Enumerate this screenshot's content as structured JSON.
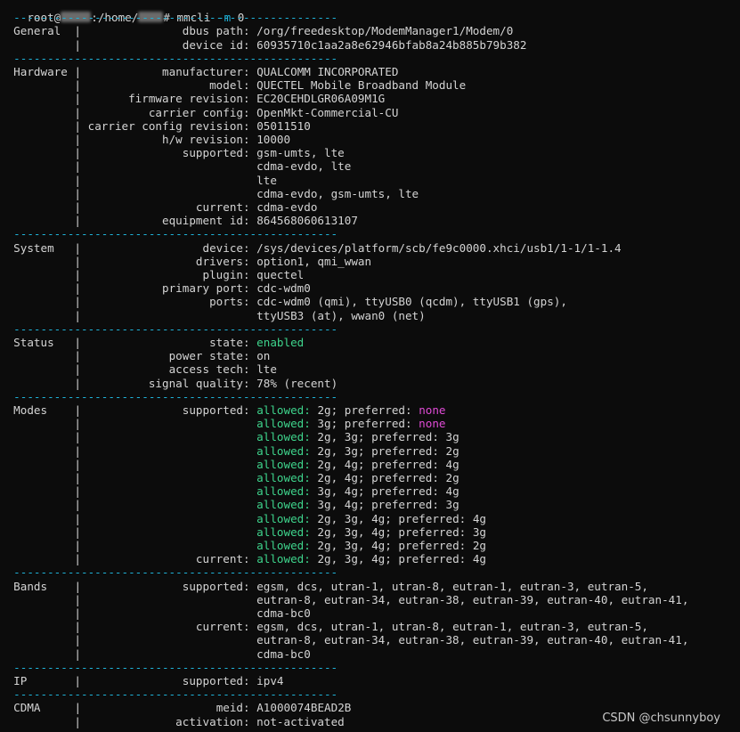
{
  "prompt": {
    "user": "root@",
    "path_a": ":/home/",
    "path_b": "# ",
    "command": "mmcli ",
    "flag": "-m",
    "arg": " 0"
  },
  "separator": "------------------------------------------------",
  "sections": [
    {
      "name": "General",
      "rows": [
        {
          "key": "dbus path:",
          "parts": [
            {
              "t": "/org/freedesktop/ModemManager1/Modem/0"
            }
          ]
        },
        {
          "key": "device id:",
          "parts": [
            {
              "t": "60935710c1aa2a8e62946bfab8a24b885b79b382"
            }
          ]
        }
      ]
    },
    {
      "name": "Hardware",
      "rows": [
        {
          "key": "manufacturer:",
          "parts": [
            {
              "t": "QUALCOMM INCORPORATED"
            }
          ]
        },
        {
          "key": "model:",
          "parts": [
            {
              "t": "QUECTEL Mobile Broadband Module"
            }
          ]
        },
        {
          "key": "firmware revision:",
          "parts": [
            {
              "t": "EC20CEHDLGR06A09M1G"
            }
          ]
        },
        {
          "key": "carrier config:",
          "parts": [
            {
              "t": "OpenMkt-Commercial-CU"
            }
          ]
        },
        {
          "key": "carrier config revision:",
          "parts": [
            {
              "t": "05011510"
            }
          ]
        },
        {
          "key": "h/w revision:",
          "parts": [
            {
              "t": "10000"
            }
          ]
        },
        {
          "key": "supported:",
          "parts": [
            {
              "t": "gsm-umts, lte"
            }
          ]
        },
        {
          "key": "",
          "parts": [
            {
              "t": "cdma-evdo, lte"
            }
          ]
        },
        {
          "key": "",
          "parts": [
            {
              "t": "lte"
            }
          ]
        },
        {
          "key": "",
          "parts": [
            {
              "t": "cdma-evdo, gsm-umts, lte"
            }
          ]
        },
        {
          "key": "current:",
          "parts": [
            {
              "t": "cdma-evdo"
            }
          ]
        },
        {
          "key": "equipment id:",
          "parts": [
            {
              "t": "864568060613107"
            }
          ]
        }
      ]
    },
    {
      "name": "System",
      "rows": [
        {
          "key": "device:",
          "parts": [
            {
              "t": "/sys/devices/platform/scb/fe9c0000.xhci/usb1/1-1/1-1.4"
            }
          ]
        },
        {
          "key": "drivers:",
          "parts": [
            {
              "t": "option1, qmi_wwan"
            }
          ]
        },
        {
          "key": "plugin:",
          "parts": [
            {
              "t": "quectel"
            }
          ]
        },
        {
          "key": "primary port:",
          "parts": [
            {
              "t": "cdc-wdm0"
            }
          ]
        },
        {
          "key": "ports:",
          "parts": [
            {
              "t": "cdc-wdm0 (qmi), ttyUSB0 (qcdm), ttyUSB1 (gps),"
            }
          ]
        },
        {
          "key": "",
          "parts": [
            {
              "t": "ttyUSB3 (at), wwan0 (net)"
            }
          ]
        }
      ]
    },
    {
      "name": "Status",
      "rows": [
        {
          "key": "state:",
          "parts": [
            {
              "t": "enabled",
              "c": "green"
            }
          ]
        },
        {
          "key": "power state:",
          "parts": [
            {
              "t": "on"
            }
          ]
        },
        {
          "key": "access tech:",
          "parts": [
            {
              "t": "lte"
            }
          ]
        },
        {
          "key": "signal quality:",
          "parts": [
            {
              "t": "78% (recent)"
            }
          ]
        }
      ]
    },
    {
      "name": "Modes",
      "rows": [
        {
          "key": "supported:",
          "parts": [
            {
              "t": "allowed:",
              "c": "green"
            },
            {
              "t": " 2g; preferred: "
            },
            {
              "t": "none",
              "c": "magenta"
            }
          ]
        },
        {
          "key": "",
          "parts": [
            {
              "t": "allowed:",
              "c": "green"
            },
            {
              "t": " 3g; preferred: "
            },
            {
              "t": "none",
              "c": "magenta"
            }
          ]
        },
        {
          "key": "",
          "parts": [
            {
              "t": "allowed:",
              "c": "green"
            },
            {
              "t": " 2g, 3g; preferred: 3g"
            }
          ]
        },
        {
          "key": "",
          "parts": [
            {
              "t": "allowed:",
              "c": "green"
            },
            {
              "t": " 2g, 3g; preferred: 2g"
            }
          ]
        },
        {
          "key": "",
          "parts": [
            {
              "t": "allowed:",
              "c": "green"
            },
            {
              "t": " 2g, 4g; preferred: 4g"
            }
          ]
        },
        {
          "key": "",
          "parts": [
            {
              "t": "allowed:",
              "c": "green"
            },
            {
              "t": " 2g, 4g; preferred: 2g"
            }
          ]
        },
        {
          "key": "",
          "parts": [
            {
              "t": "allowed:",
              "c": "green"
            },
            {
              "t": " 3g, 4g; preferred: 4g"
            }
          ]
        },
        {
          "key": "",
          "parts": [
            {
              "t": "allowed:",
              "c": "green"
            },
            {
              "t": " 3g, 4g; preferred: 3g"
            }
          ]
        },
        {
          "key": "",
          "parts": [
            {
              "t": "allowed:",
              "c": "green"
            },
            {
              "t": " 2g, 3g, 4g; preferred: 4g"
            }
          ]
        },
        {
          "key": "",
          "parts": [
            {
              "t": "allowed:",
              "c": "green"
            },
            {
              "t": " 2g, 3g, 4g; preferred: 3g"
            }
          ]
        },
        {
          "key": "",
          "parts": [
            {
              "t": "allowed:",
              "c": "green"
            },
            {
              "t": " 2g, 3g, 4g; preferred: 2g"
            }
          ]
        },
        {
          "key": "current:",
          "parts": [
            {
              "t": "allowed:",
              "c": "green"
            },
            {
              "t": " 2g, 3g, 4g; preferred: 4g"
            }
          ]
        }
      ]
    },
    {
      "name": "Bands",
      "rows": [
        {
          "key": "supported:",
          "parts": [
            {
              "t": "egsm, dcs, utran-1, utran-8, eutran-1, eutran-3, eutran-5,"
            }
          ]
        },
        {
          "key": "",
          "parts": [
            {
              "t": "eutran-8, eutran-34, eutran-38, eutran-39, eutran-40, eutran-41,"
            }
          ]
        },
        {
          "key": "",
          "parts": [
            {
              "t": "cdma-bc0"
            }
          ]
        },
        {
          "key": "current:",
          "parts": [
            {
              "t": "egsm, dcs, utran-1, utran-8, eutran-1, eutran-3, eutran-5,"
            }
          ]
        },
        {
          "key": "",
          "parts": [
            {
              "t": "eutran-8, eutran-34, eutran-38, eutran-39, eutran-40, eutran-41,"
            }
          ]
        },
        {
          "key": "",
          "parts": [
            {
              "t": "cdma-bc0"
            }
          ]
        }
      ]
    },
    {
      "name": "IP",
      "rows": [
        {
          "key": "supported:",
          "parts": [
            {
              "t": "ipv4"
            }
          ]
        }
      ]
    },
    {
      "name": "CDMA",
      "rows": [
        {
          "key": "meid:",
          "parts": [
            {
              "t": "A1000074BEAD2B"
            }
          ]
        },
        {
          "key": "activation:",
          "parts": [
            {
              "t": "not-activated"
            }
          ]
        }
      ]
    }
  ],
  "watermark": "CSDN @chsunnyboy",
  "colors": {
    "background": "#0c0c0c",
    "text": "#d4d4d4",
    "separator": "#1fb3d9",
    "flag": "#1fb3d9",
    "green": "#3ed48c",
    "magenta": "#e04bd6"
  }
}
